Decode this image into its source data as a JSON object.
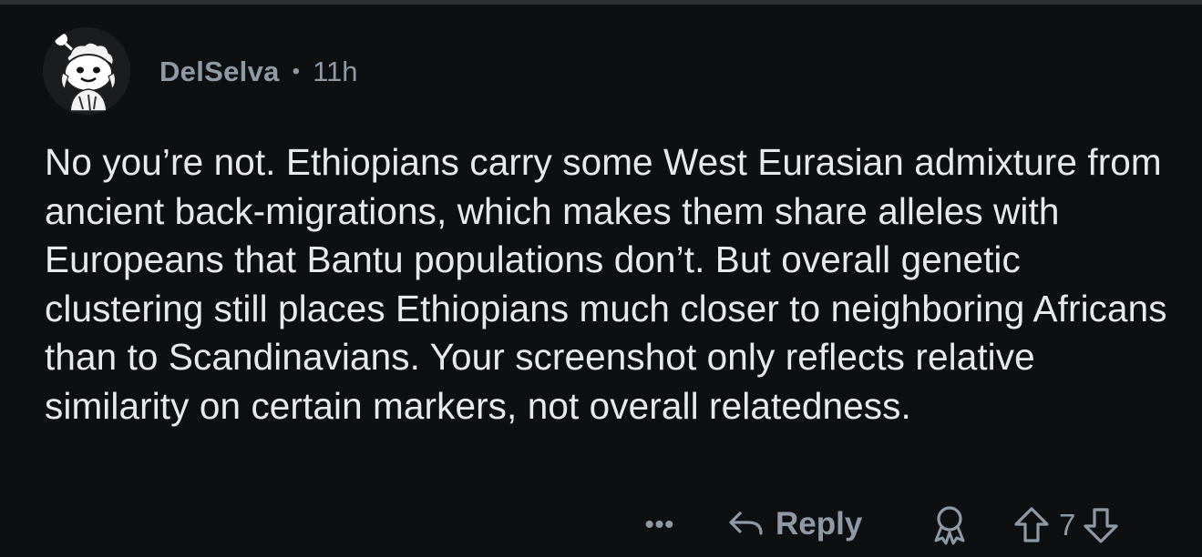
{
  "comment": {
    "username": "DelSelva",
    "separator": "•",
    "timestamp": "11h",
    "body": "No you’re not. Ethiopians carry some West Eurasian admixture from ancient back-migrations, which makes them share alleles with Europeans that Bantu populations don’t. But overall genetic clustering still places Ethiopians much closer to neighboring Africans than to Scandinavians. Your screenshot only reflects relative similarity on certain markers, not overall relatedness.",
    "avatar_icon": "snoo-avatar-icon"
  },
  "actions": {
    "more_label": "•••",
    "reply_label": "Reply",
    "reply_icon": "reply-arrow-icon",
    "award_icon": "award-icon",
    "upvote_icon": "upvote-arrow-icon",
    "downvote_icon": "downvote-arrow-icon",
    "vote_count": "7"
  },
  "colors": {
    "background": "#0e0f11",
    "text": "#e7e9ea",
    "muted": "#8e9ba6"
  }
}
